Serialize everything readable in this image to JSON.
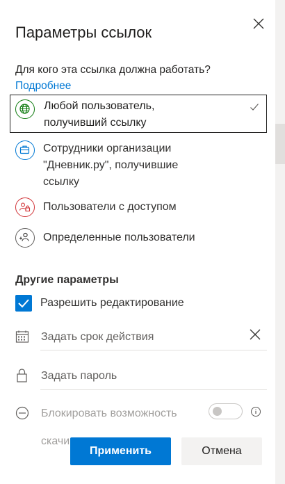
{
  "dialog": {
    "title": "Параметры ссылок",
    "question": "Для кого эта ссылка должна работать?",
    "more_link": "Подробнее"
  },
  "options": [
    {
      "line1": "Любой пользователь,",
      "line2": "получивший ссылку",
      "icon": "globe-icon",
      "selected": true
    },
    {
      "line1": "Сотрудники организации",
      "line2": "\"Дневник.ру\", получившие",
      "line3": "ссылку",
      "icon": "briefcase-icon"
    },
    {
      "line1": "Пользователи с доступом",
      "icon": "people-lock-icon"
    },
    {
      "line1": "Определенные пользователи",
      "icon": "people-add-icon"
    }
  ],
  "other": {
    "heading": "Другие параметры",
    "allow_edit": "Разрешить редактирование",
    "allow_edit_checked": true,
    "expiry_placeholder": "Задать срок действия",
    "password_placeholder": "Задать пароль",
    "block_download_line1": "Блокировать возможность",
    "block_download_line2": "скачи",
    "block_download_on": false
  },
  "buttons": {
    "apply": "Применить",
    "cancel": "Отмена"
  },
  "colors": {
    "accent": "#0078d4",
    "globe": "#107c10",
    "briefcase": "#0078d4",
    "lock_people": "#d13438",
    "text": "#323130"
  }
}
